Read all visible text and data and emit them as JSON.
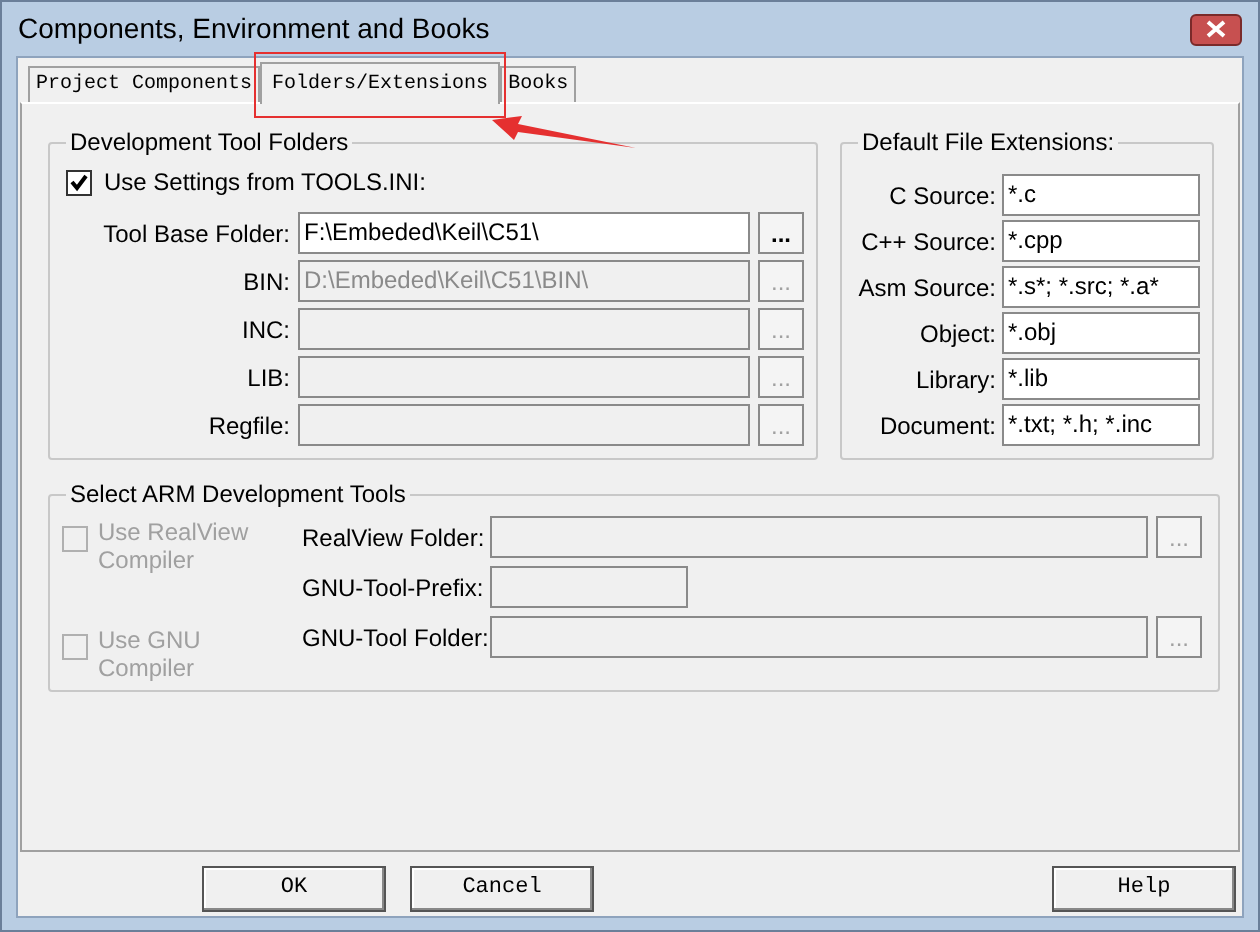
{
  "window": {
    "title": "Components, Environment and Books"
  },
  "tabs": [
    {
      "label": "Project Components",
      "selected": false
    },
    {
      "label": "Folders/Extensions",
      "selected": true
    },
    {
      "label": "Books",
      "selected": false
    }
  ],
  "dev_tool_folders": {
    "title": "Development Tool Folders",
    "use_tools_ini": {
      "label": "Use Settings from TOOLS.INI:",
      "checked": true
    },
    "rows": [
      {
        "label": "Tool Base Folder:",
        "value": "F:\\Embeded\\Keil\\C51\\",
        "disabled": false,
        "button": "..."
      },
      {
        "label": "BIN:",
        "value": "D:\\Embeded\\Keil\\C51\\BIN\\",
        "disabled": true,
        "button": "..."
      },
      {
        "label": "INC:",
        "disabled": true,
        "button": "..."
      },
      {
        "label": "LIB:",
        "disabled": true,
        "button": "..."
      },
      {
        "label": "Regfile:",
        "disabled": true,
        "button": "..."
      }
    ]
  },
  "file_extensions": {
    "title": "Default File Extensions:",
    "rows": [
      {
        "label": "C Source:",
        "value": "*.c"
      },
      {
        "label": "C++ Source:",
        "value": "*.cpp"
      },
      {
        "label": "Asm Source:",
        "value": "*.s*; *.src; *.a*"
      },
      {
        "label": "Object:",
        "value": "*.obj"
      },
      {
        "label": "Library:",
        "value": "*.lib"
      },
      {
        "label": "Document:",
        "value": "*.txt; *.h; *.inc"
      }
    ]
  },
  "arm_tools": {
    "title": "Select ARM Development Tools",
    "options": [
      {
        "label": "Use RealView Compiler",
        "checked": false,
        "disabled": true
      },
      {
        "label": "Use GNU Compiler",
        "checked": false,
        "disabled": true
      }
    ],
    "fields": [
      {
        "label": "RealView Folder:",
        "disabled": true,
        "button": "..."
      },
      {
        "label": "GNU-Tool-Prefix:",
        "disabled": true
      },
      {
        "label": "GNU-Tool Folder:",
        "disabled": true,
        "button": "..."
      }
    ]
  },
  "buttons": [
    "OK",
    "Cancel",
    "Help"
  ]
}
